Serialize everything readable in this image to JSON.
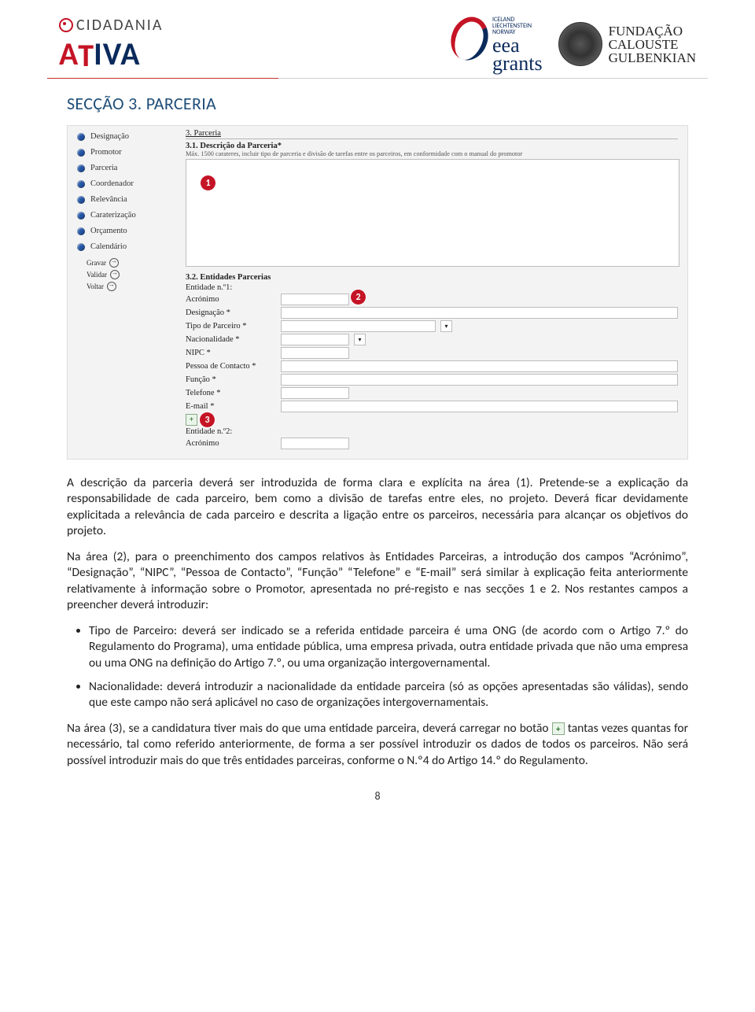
{
  "header": {
    "brand_top": "CIDADANIA",
    "brand_bottom": "ATIVA",
    "eea": {
      "donors": "ICELAND\nLIECHTENSTEIN\nNORWAY",
      "line1": "eea",
      "line2": "grants"
    },
    "gulbenkian": {
      "l1": "FUNDAÇÃO",
      "l2": "CALOUSTE",
      "l3": "GULBENKIAN"
    }
  },
  "section_title": "SECÇÃO 3. PARCERIA",
  "screenshot": {
    "sec3": "3. Parceria",
    "sec31": "3.1. Descrição da Parceria*",
    "hint31": "Máx. 1500 carateres, incluir tipo de parceria e divisão de tarefas entre os parceiros, em conformidade com o manual do promotor",
    "sec32": "3.2. Entidades Parcerias",
    "ent1": "Entidade n.º1:",
    "ent2": "Entidade n.º2:",
    "nav": [
      "Designação",
      "Promotor",
      "Parceria",
      "Coordenador",
      "Relevância",
      "Caraterização",
      "Orçamento",
      "Calendário"
    ],
    "actions": [
      "Gravar",
      "Validar",
      "Voltar"
    ],
    "fields": {
      "acronimo": "Acrónimo",
      "designacao": "Designação *",
      "tipo": "Tipo de Parceiro *",
      "nacionalidade": "Nacionalidade *",
      "nipc": "NIPC *",
      "pessoa": "Pessoa de Contacto *",
      "funcao": "Função *",
      "telefone": "Telefone *",
      "email": "E-mail *",
      "acronimo2": "Acrónimo"
    }
  },
  "markers": {
    "m1": "1",
    "m2": "2",
    "m3": "3"
  },
  "body": {
    "p1": "A descrição da parceria deverá ser introduzida de forma clara e explícita na área (1). Pretende-se a explicação da responsabilidade de cada parceiro, bem como a divisão de tarefas entre eles, no projeto. Deverá ficar devidamente explicitada a relevância de cada parceiro e descrita a ligação entre os parceiros, necessária para alcançar os objetivos do projeto.",
    "p2": "Na área (2), para o preenchimento dos campos relativos às Entidades Parceiras, a introdução dos campos “Acrónimo”, “Designação”, “NIPC”, “Pessoa de Contacto”, “Função” “Telefone” e “E-mail” será similar à explicação feita anteriormente relativamente à informação sobre o Promotor, apresentada no pré-registo e nas secções 1 e 2. Nos restantes campos a preencher deverá introduzir:",
    "li1": "Tipo de Parceiro: deverá ser indicado se a referida entidade parceira é uma ONG (de acordo com o Artigo 7.º do Regulamento do Programa), uma entidade pública, uma empresa privada, outra entidade privada que não uma empresa ou uma ONG na definição do Artigo 7.º, ou uma organização intergovernamental.",
    "li2": "Nacionalidade: deverá introduzir a nacionalidade da entidade parceira (só as opções apresentadas são válidas), sendo que este campo não será aplicável no caso de organizações intergovernamentais.",
    "p3a": "Na área (3), se a candidatura tiver mais do que uma entidade parceira, deverá carregar no botão ",
    "p3b": " tantas vezes quantas for necessário, tal como referido anteriormente, de forma a ser possível introduzir os dados de todos os parceiros. Não será possível introduzir mais do que três entidades parceiras, conforme o N.º4 do Artigo 14.º do Regulamento."
  },
  "page_number": "8"
}
